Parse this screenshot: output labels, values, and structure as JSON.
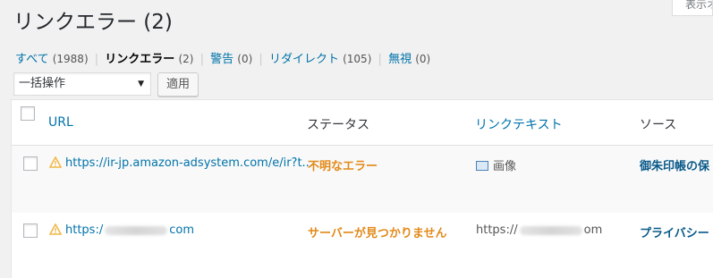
{
  "page": {
    "title": "リンクエラー (2)",
    "screen_options_label": "表示オプション"
  },
  "filters": [
    {
      "label": "すべて",
      "count": "(1988)",
      "current": false
    },
    {
      "label": "リンクエラー",
      "count": "(2)",
      "current": true
    },
    {
      "label": "警告",
      "count": "(0)",
      "current": false
    },
    {
      "label": "リダイレクト",
      "count": "(105)",
      "current": false
    },
    {
      "label": "無視",
      "count": "(0)",
      "current": false
    }
  ],
  "bulk": {
    "select_value": "一括操作",
    "apply_label": "適用"
  },
  "table": {
    "columns": [
      "URL",
      "ステータス",
      "リンクテキスト",
      "ソース"
    ],
    "rows": [
      {
        "url": "https://ir-jp.amazon-adsystem.com/e/ir?t...",
        "status": "不明なエラー",
        "link_text": "画像",
        "source": "御朱印帳の保"
      },
      {
        "url_prefix": "https:/",
        "url_suffix": "com",
        "status": "サーバーが見つかりません",
        "link_text_prefix": "https://",
        "link_text_suffix": "om",
        "source": "プライバシー"
      }
    ]
  },
  "colors": {
    "link": "#0073aa",
    "status_error": "#e28a1a",
    "warning_icon": "#f0b849"
  }
}
